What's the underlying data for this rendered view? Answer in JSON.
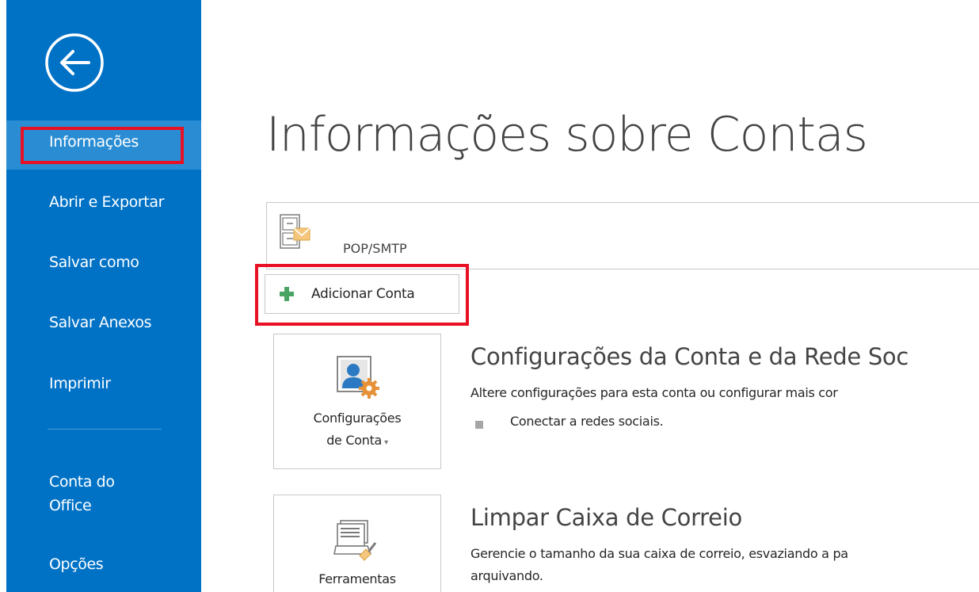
{
  "sidebar": {
    "items": [
      {
        "label": "Informações"
      },
      {
        "label": "Abrir e Exportar"
      },
      {
        "label": "Salvar como"
      },
      {
        "label": "Salvar Anexos"
      },
      {
        "label": "Imprimir"
      }
    ],
    "office_account": {
      "line1": "Conta do",
      "line2": "Office"
    },
    "options": "Opções",
    "back_icon": "back-arrow-circle-icon"
  },
  "main": {
    "title": "Informações sobre Contas",
    "account_type": "POP/SMTP",
    "add_account": "Adicionar Conta",
    "sections": [
      {
        "tile_label_1": "Configurações",
        "tile_label_2": "de Conta",
        "title": "Configurações da Conta e da Rede Soc",
        "description": "Altere configurações para esta conta ou configurar mais cor",
        "bullet": "Conectar a redes sociais."
      },
      {
        "tile_label_1": "Ferramentas",
        "title": "Limpar Caixa de Correio",
        "description_1": "Gerencie o tamanho da sua caixa de correio, esvaziando a pa",
        "description_2": "arquivando."
      }
    ]
  },
  "colors": {
    "sidebar": "#0072c6",
    "selected": "#2a8dd4",
    "highlight": "#e81123",
    "plus": "#4aa564"
  }
}
